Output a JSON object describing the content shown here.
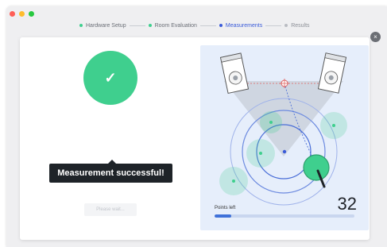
{
  "window": {
    "traffic_lights": [
      {
        "name": "close",
        "color": "#fe5f57"
      },
      {
        "name": "minimize",
        "color": "#febc2e"
      },
      {
        "name": "zoom",
        "color": "#28c840"
      }
    ]
  },
  "steps": [
    {
      "label": "Hardware Setup",
      "state": "done",
      "color": "#3fcf8e"
    },
    {
      "label": "Room Evaluation",
      "state": "done",
      "color": "#3fcf8e"
    },
    {
      "label": "Measurements",
      "state": "active",
      "color": "#3a5bd9"
    },
    {
      "label": "Results",
      "state": "future",
      "color": "#b9bcc2"
    }
  ],
  "dialog": {
    "close_icon": "×",
    "success_icon": "✓",
    "tooltip_text": "Measurement successful!",
    "wait_button_label": "Please wait..."
  },
  "measurement": {
    "points_left_label": "Points left",
    "points_left_value": "32",
    "progress_fraction": 0.12
  },
  "colors": {
    "accent_green": "#3fcf8e",
    "accent_blue": "#3f71d9",
    "panel_bg": "#e6eefb"
  }
}
